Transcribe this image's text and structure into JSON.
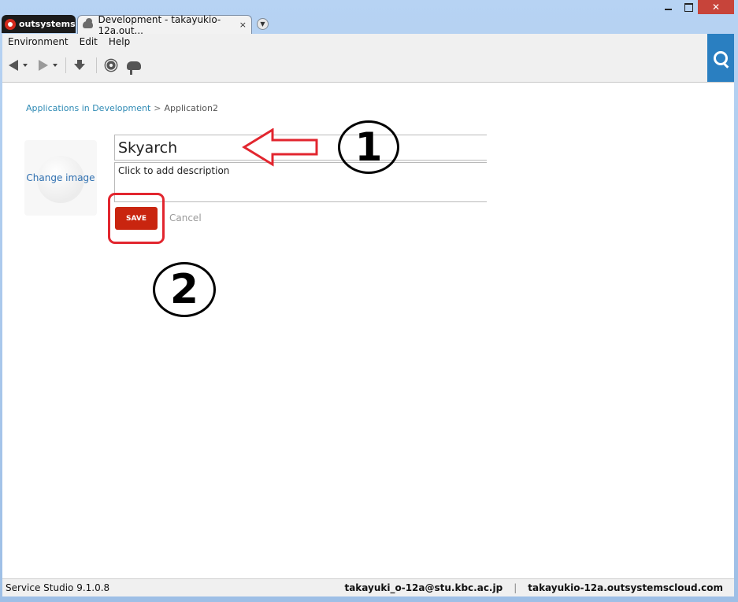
{
  "window": {
    "brand_tab_label": "outsystems",
    "tab_title": "Development - takayukio-12a.out...",
    "tab_close": "×",
    "tab_dropdown": "▼",
    "close_glyph": "✕"
  },
  "menu": [
    "Environment",
    "Edit",
    "Help"
  ],
  "toolbar": {
    "icons": [
      "back-arrow-icon",
      "forward-arrow-icon",
      "download-icon",
      "gear-icon",
      "publish-icon",
      "search-icon"
    ]
  },
  "breadcrumb": {
    "parent": "Applications in Development",
    "separator": ">",
    "current": "Application2"
  },
  "app_form": {
    "change_image_label": "Change image",
    "name_value": "Skyarch",
    "description_placeholder": "Click to add description",
    "save_label": "SAVE",
    "cancel_label": "Cancel"
  },
  "annotations": {
    "one": "1",
    "two": "2",
    "highlight_color": "#e2262f"
  },
  "status": {
    "version": "Service Studio 9.1.0.8",
    "user": "takayuki_o-12a@stu.kbc.ac.jp",
    "separator": "|",
    "server": "takayukio-12a.outsystemscloud.com"
  },
  "colors": {
    "save_button": "#c9250f",
    "link": "#2e8ab4",
    "accent_search": "#2a7fc1"
  }
}
